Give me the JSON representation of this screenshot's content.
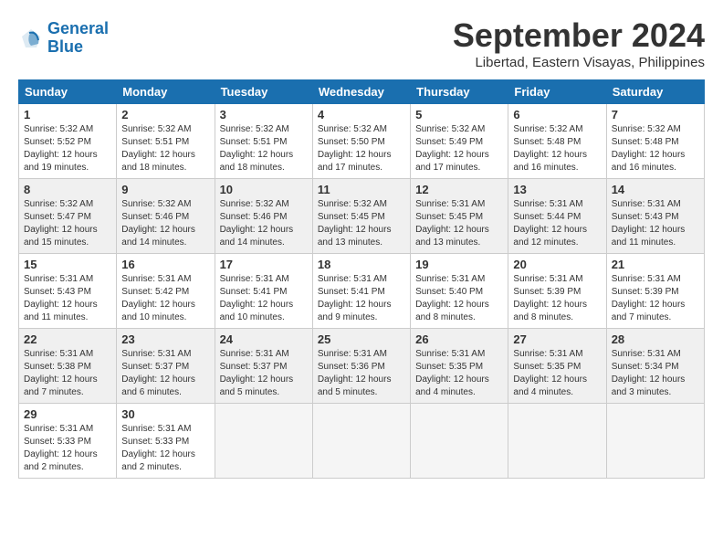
{
  "header": {
    "logo_line1": "General",
    "logo_line2": "Blue",
    "month_title": "September 2024",
    "location": "Libertad, Eastern Visayas, Philippines"
  },
  "weekdays": [
    "Sunday",
    "Monday",
    "Tuesday",
    "Wednesday",
    "Thursday",
    "Friday",
    "Saturday"
  ],
  "weeks": [
    [
      {
        "day": "1",
        "lines": [
          "Sunrise: 5:32 AM",
          "Sunset: 5:52 PM",
          "Daylight: 12 hours",
          "and 19 minutes."
        ]
      },
      {
        "day": "2",
        "lines": [
          "Sunrise: 5:32 AM",
          "Sunset: 5:51 PM",
          "Daylight: 12 hours",
          "and 18 minutes."
        ]
      },
      {
        "day": "3",
        "lines": [
          "Sunrise: 5:32 AM",
          "Sunset: 5:51 PM",
          "Daylight: 12 hours",
          "and 18 minutes."
        ]
      },
      {
        "day": "4",
        "lines": [
          "Sunrise: 5:32 AM",
          "Sunset: 5:50 PM",
          "Daylight: 12 hours",
          "and 17 minutes."
        ]
      },
      {
        "day": "5",
        "lines": [
          "Sunrise: 5:32 AM",
          "Sunset: 5:49 PM",
          "Daylight: 12 hours",
          "and 17 minutes."
        ]
      },
      {
        "day": "6",
        "lines": [
          "Sunrise: 5:32 AM",
          "Sunset: 5:48 PM",
          "Daylight: 12 hours",
          "and 16 minutes."
        ]
      },
      {
        "day": "7",
        "lines": [
          "Sunrise: 5:32 AM",
          "Sunset: 5:48 PM",
          "Daylight: 12 hours",
          "and 16 minutes."
        ]
      }
    ],
    [
      {
        "day": "8",
        "lines": [
          "Sunrise: 5:32 AM",
          "Sunset: 5:47 PM",
          "Daylight: 12 hours",
          "and 15 minutes."
        ]
      },
      {
        "day": "9",
        "lines": [
          "Sunrise: 5:32 AM",
          "Sunset: 5:46 PM",
          "Daylight: 12 hours",
          "and 14 minutes."
        ]
      },
      {
        "day": "10",
        "lines": [
          "Sunrise: 5:32 AM",
          "Sunset: 5:46 PM",
          "Daylight: 12 hours",
          "and 14 minutes."
        ]
      },
      {
        "day": "11",
        "lines": [
          "Sunrise: 5:32 AM",
          "Sunset: 5:45 PM",
          "Daylight: 12 hours",
          "and 13 minutes."
        ]
      },
      {
        "day": "12",
        "lines": [
          "Sunrise: 5:31 AM",
          "Sunset: 5:45 PM",
          "Daylight: 12 hours",
          "and 13 minutes."
        ]
      },
      {
        "day": "13",
        "lines": [
          "Sunrise: 5:31 AM",
          "Sunset: 5:44 PM",
          "Daylight: 12 hours",
          "and 12 minutes."
        ]
      },
      {
        "day": "14",
        "lines": [
          "Sunrise: 5:31 AM",
          "Sunset: 5:43 PM",
          "Daylight: 12 hours",
          "and 11 minutes."
        ]
      }
    ],
    [
      {
        "day": "15",
        "lines": [
          "Sunrise: 5:31 AM",
          "Sunset: 5:43 PM",
          "Daylight: 12 hours",
          "and 11 minutes."
        ]
      },
      {
        "day": "16",
        "lines": [
          "Sunrise: 5:31 AM",
          "Sunset: 5:42 PM",
          "Daylight: 12 hours",
          "and 10 minutes."
        ]
      },
      {
        "day": "17",
        "lines": [
          "Sunrise: 5:31 AM",
          "Sunset: 5:41 PM",
          "Daylight: 12 hours",
          "and 10 minutes."
        ]
      },
      {
        "day": "18",
        "lines": [
          "Sunrise: 5:31 AM",
          "Sunset: 5:41 PM",
          "Daylight: 12 hours",
          "and 9 minutes."
        ]
      },
      {
        "day": "19",
        "lines": [
          "Sunrise: 5:31 AM",
          "Sunset: 5:40 PM",
          "Daylight: 12 hours",
          "and 8 minutes."
        ]
      },
      {
        "day": "20",
        "lines": [
          "Sunrise: 5:31 AM",
          "Sunset: 5:39 PM",
          "Daylight: 12 hours",
          "and 8 minutes."
        ]
      },
      {
        "day": "21",
        "lines": [
          "Sunrise: 5:31 AM",
          "Sunset: 5:39 PM",
          "Daylight: 12 hours",
          "and 7 minutes."
        ]
      }
    ],
    [
      {
        "day": "22",
        "lines": [
          "Sunrise: 5:31 AM",
          "Sunset: 5:38 PM",
          "Daylight: 12 hours",
          "and 7 minutes."
        ]
      },
      {
        "day": "23",
        "lines": [
          "Sunrise: 5:31 AM",
          "Sunset: 5:37 PM",
          "Daylight: 12 hours",
          "and 6 minutes."
        ]
      },
      {
        "day": "24",
        "lines": [
          "Sunrise: 5:31 AM",
          "Sunset: 5:37 PM",
          "Daylight: 12 hours",
          "and 5 minutes."
        ]
      },
      {
        "day": "25",
        "lines": [
          "Sunrise: 5:31 AM",
          "Sunset: 5:36 PM",
          "Daylight: 12 hours",
          "and 5 minutes."
        ]
      },
      {
        "day": "26",
        "lines": [
          "Sunrise: 5:31 AM",
          "Sunset: 5:35 PM",
          "Daylight: 12 hours",
          "and 4 minutes."
        ]
      },
      {
        "day": "27",
        "lines": [
          "Sunrise: 5:31 AM",
          "Sunset: 5:35 PM",
          "Daylight: 12 hours",
          "and 4 minutes."
        ]
      },
      {
        "day": "28",
        "lines": [
          "Sunrise: 5:31 AM",
          "Sunset: 5:34 PM",
          "Daylight: 12 hours",
          "and 3 minutes."
        ]
      }
    ],
    [
      {
        "day": "29",
        "lines": [
          "Sunrise: 5:31 AM",
          "Sunset: 5:33 PM",
          "Daylight: 12 hours",
          "and 2 minutes."
        ]
      },
      {
        "day": "30",
        "lines": [
          "Sunrise: 5:31 AM",
          "Sunset: 5:33 PM",
          "Daylight: 12 hours",
          "and 2 minutes."
        ]
      },
      {
        "day": "",
        "lines": []
      },
      {
        "day": "",
        "lines": []
      },
      {
        "day": "",
        "lines": []
      },
      {
        "day": "",
        "lines": []
      },
      {
        "day": "",
        "lines": []
      }
    ]
  ]
}
